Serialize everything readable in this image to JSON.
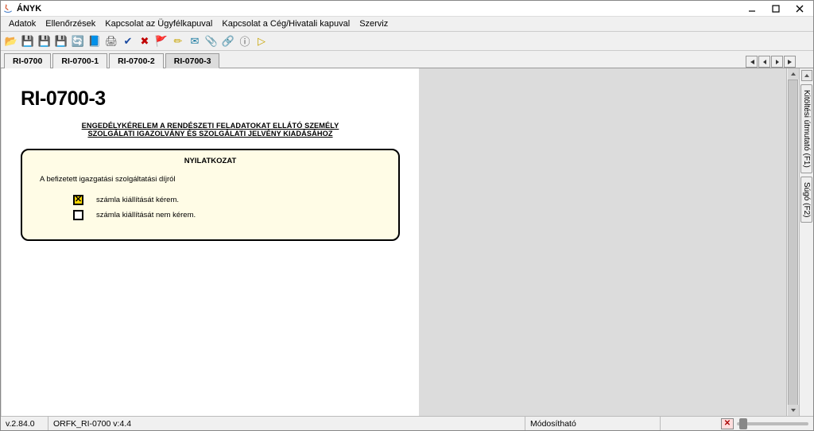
{
  "title": "ÁNYK",
  "menu": [
    "Adatok",
    "Ellenőrzések",
    "Kapcsolat az Ügyfélkapuval",
    "Kapcsolat a Cég/Hivatali kapuval",
    "Szerviz"
  ],
  "toolbar_icons": [
    {
      "name": "open-folder-icon",
      "color": "#c97a00",
      "glyph": "📂"
    },
    {
      "name": "save-icon",
      "color": "#000",
      "glyph": "💾"
    },
    {
      "name": "save-as-icon",
      "color": "#000",
      "glyph": "💾"
    },
    {
      "name": "save-all-icon",
      "color": "#000",
      "glyph": "💾"
    },
    {
      "name": "refresh-icon",
      "color": "#1a7a1a",
      "glyph": "🔄"
    },
    {
      "name": "doc-icon",
      "color": "#1a4aa0",
      "glyph": "📘"
    },
    {
      "name": "print-icon",
      "color": "#555",
      "glyph": "🖨"
    },
    {
      "name": "check-icon",
      "color": "#1a4aa0",
      "glyph": "✔"
    },
    {
      "name": "cancel-icon",
      "color": "#c00000",
      "glyph": "✖"
    },
    {
      "name": "flag-icon",
      "color": "#c8a400",
      "glyph": "🚩"
    },
    {
      "name": "edit-icon",
      "color": "#c8a400",
      "glyph": "✏"
    },
    {
      "name": "mail-icon",
      "color": "#1a7aa0",
      "glyph": "✉"
    },
    {
      "name": "attach-icon",
      "color": "#1a7a1a",
      "glyph": "📎"
    },
    {
      "name": "link-icon",
      "color": "#c8a400",
      "glyph": "🔗"
    },
    {
      "name": "info-icon",
      "color": "#555",
      "glyph": "ⓘ"
    },
    {
      "name": "run-icon",
      "color": "#c8a400",
      "glyph": "▷"
    }
  ],
  "tabs": [
    {
      "id": "t0",
      "label": "RI-0700",
      "active": false
    },
    {
      "id": "t1",
      "label": "RI-0700-1",
      "active": false
    },
    {
      "id": "t2",
      "label": "RI-0700-2",
      "active": false
    },
    {
      "id": "t3",
      "label": "RI-0700-3",
      "active": true
    }
  ],
  "side_tabs": [
    "Kitöltési útmutató (F1)",
    "Súgó (F2)"
  ],
  "form": {
    "title": "RI-0700-3",
    "header1": "ENGEDÉLYKÉRELEM A RENDÉSZETI FELADATOKAT ELLÁTÓ SZEMÉLY",
    "header2": "SZOLGÁLATI IGAZOLVÁNY ÉS SZOLGÁLATI JELVÉNY KIADÁSÁHOZ",
    "box_title": "NYILATKOZAT",
    "box_intro": "A befizetett igazgatási szolgáltatási díjról",
    "options": [
      {
        "checked": true,
        "label": "számla kiállítását kérem."
      },
      {
        "checked": false,
        "label": "számla kiállítását nem kérem."
      }
    ]
  },
  "status": {
    "version": "v.2.84.0",
    "template": "ORFK_RI-0700 v:4.4",
    "state": "Módosítható"
  }
}
